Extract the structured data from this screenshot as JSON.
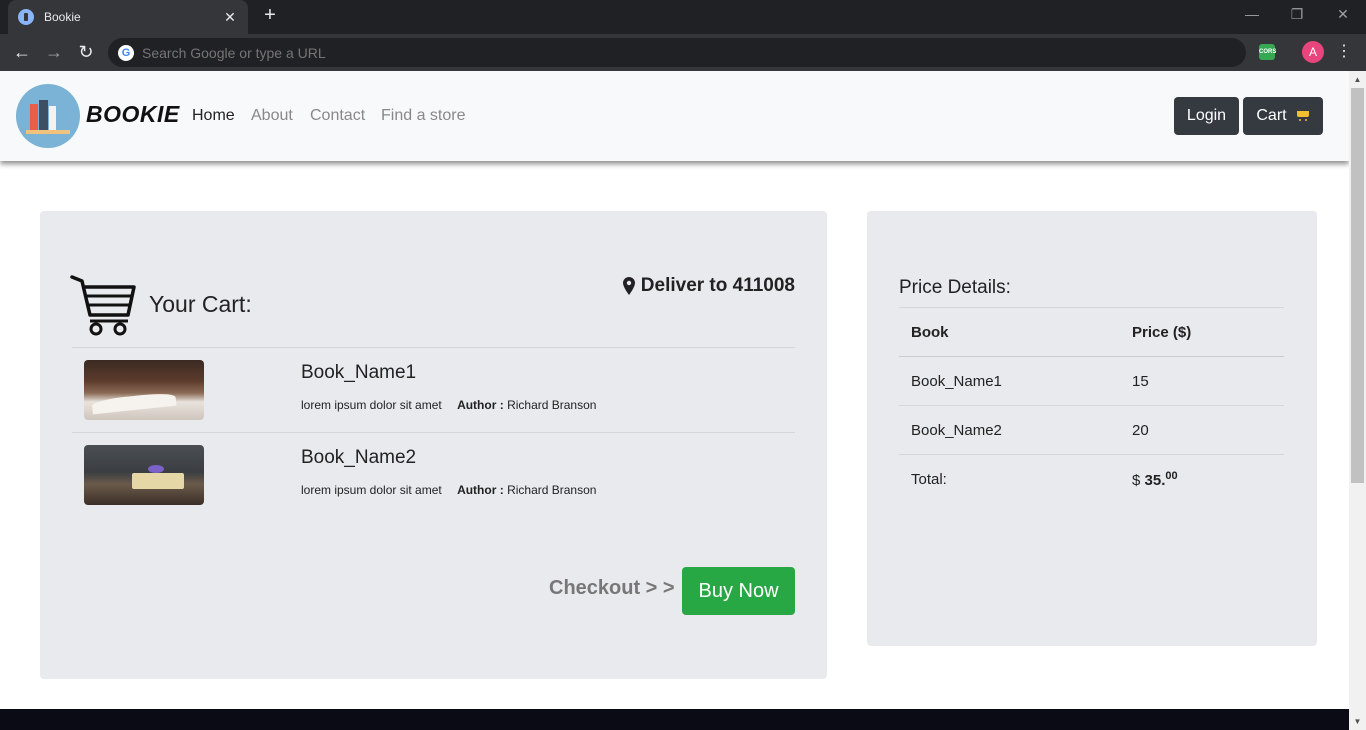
{
  "browser": {
    "tab_title": "Bookie",
    "tab_close": "✕",
    "new_tab": "+",
    "minimize": "—",
    "restore": "❐",
    "close": "✕",
    "omnibox_placeholder": "Search Google or type a URL",
    "extension_label": "CORS",
    "profile_initial": "A"
  },
  "navbar": {
    "brand": "BOOKIE",
    "links": [
      "Home",
      "About",
      "Contact",
      "Find a store"
    ],
    "login_label": "Login",
    "cart_label": "Cart"
  },
  "cart": {
    "heading": "Your Cart:",
    "deliver_to": "Deliver to 411008",
    "items": [
      {
        "name": "Book_Name1",
        "description": "lorem ipsum dolor sit amet",
        "author_label": "Author :",
        "author": "Richard Branson"
      },
      {
        "name": "Book_Name2",
        "description": "lorem ipsum dolor sit amet",
        "author_label": "Author :",
        "author": "Richard Branson"
      }
    ],
    "checkout_label": "Checkout > >",
    "buy_label": "Buy Now"
  },
  "price_details": {
    "title": "Price Details:",
    "headers": [
      "Book",
      "Price ($)"
    ],
    "rows": [
      {
        "book": "Book_Name1",
        "price": "15"
      },
      {
        "book": "Book_Name2",
        "price": "20"
      }
    ],
    "total_label": "Total:",
    "currency": "$",
    "total_main": "35.",
    "total_cents": "00"
  },
  "colors": {
    "accent_green": "#28a745",
    "dark_button": "#343a40",
    "card_bg": "#e8eaed"
  }
}
